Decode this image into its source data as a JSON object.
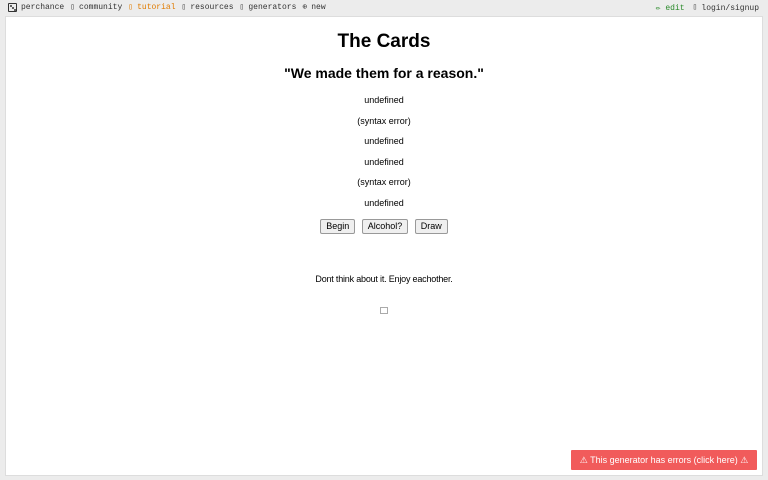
{
  "nav": {
    "items": [
      {
        "label": "perchance",
        "icon": "die-icon"
      },
      {
        "label": "community",
        "icon": "phone-icon"
      },
      {
        "label": "tutorial",
        "icon": "book-icon"
      },
      {
        "label": "resources",
        "icon": "tools-icon"
      },
      {
        "label": "generators",
        "icon": "list-icon"
      },
      {
        "label": "new",
        "icon": "plus-circle-icon"
      }
    ],
    "edit": "✏ edit",
    "login": "login/signup",
    "tutorial_color": "#e07b00",
    "edit_color": "#2a8a2a"
  },
  "page": {
    "title": "The Cards",
    "subtitle": "\"We made them for a reason.\"",
    "lines": [
      "undefined",
      "(syntax error)",
      "undefined",
      "undefined",
      "(syntax error)",
      "undefined"
    ],
    "buttons": {
      "begin": "Begin",
      "alcohol": "Alcohol?",
      "draw": "Draw"
    },
    "tagline": "Dont think about it. Enjoy eachother."
  },
  "error_banner": {
    "text": "⚠ This generator has errors (click here) ⚠",
    "color": "#f15b5b"
  }
}
